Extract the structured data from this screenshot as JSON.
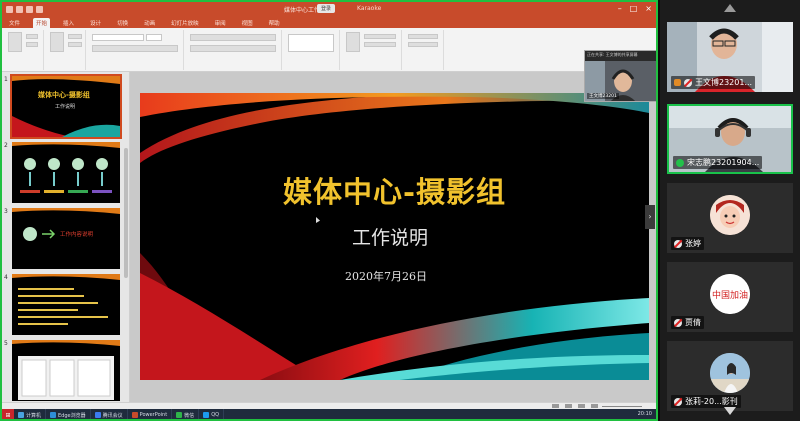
{
  "app": {
    "title": "媒体中心工作说明",
    "tag": "登录",
    "account": "Karaoke",
    "tabs": [
      "文件",
      "开始",
      "插入",
      "设计",
      "切换",
      "动画",
      "幻灯片放映",
      "审阅",
      "视图",
      "帮助"
    ],
    "active_tab": "开始"
  },
  "slide": {
    "title": "媒体中心-摄影组",
    "subtitle": "工作说明",
    "date": "2020年7月26日",
    "title_color": "#f1c22d"
  },
  "thumbnails": [
    {
      "number": "1",
      "title": "媒体中心-摄影组",
      "subtitle": "工作说明"
    },
    {
      "number": "2"
    },
    {
      "number": "3",
      "text": "工作内容说明"
    },
    {
      "number": "4"
    },
    {
      "number": "5"
    }
  ],
  "pip": {
    "header": "正在共享: 王文博的共享屏幕",
    "name": "王文博23201"
  },
  "participants": [
    {
      "name": "王文博23201...",
      "mic": "off",
      "host": true,
      "active": false
    },
    {
      "name": "宋志鹏23201904...",
      "mic": "on",
      "host": false,
      "active": true
    },
    {
      "name": "张婷",
      "mic": "off",
      "host": false,
      "active": false
    },
    {
      "name": "贾倩",
      "mic": "off",
      "host": false,
      "active": false
    },
    {
      "name": "张莉-20...影刊",
      "mic": "off",
      "host": false,
      "active": false
    }
  ],
  "avatar_text": {
    "seal": "中国加油"
  },
  "taskbar": {
    "apps": [
      "计算机",
      "Edge浏览器",
      "腾讯会议",
      "PowerPoint",
      "微信",
      "QQ"
    ],
    "clock": "20:10"
  },
  "colors": {
    "ppt_accent": "#c84b2b",
    "active_border": "#19c24a",
    "mic_off": "#e02323"
  }
}
